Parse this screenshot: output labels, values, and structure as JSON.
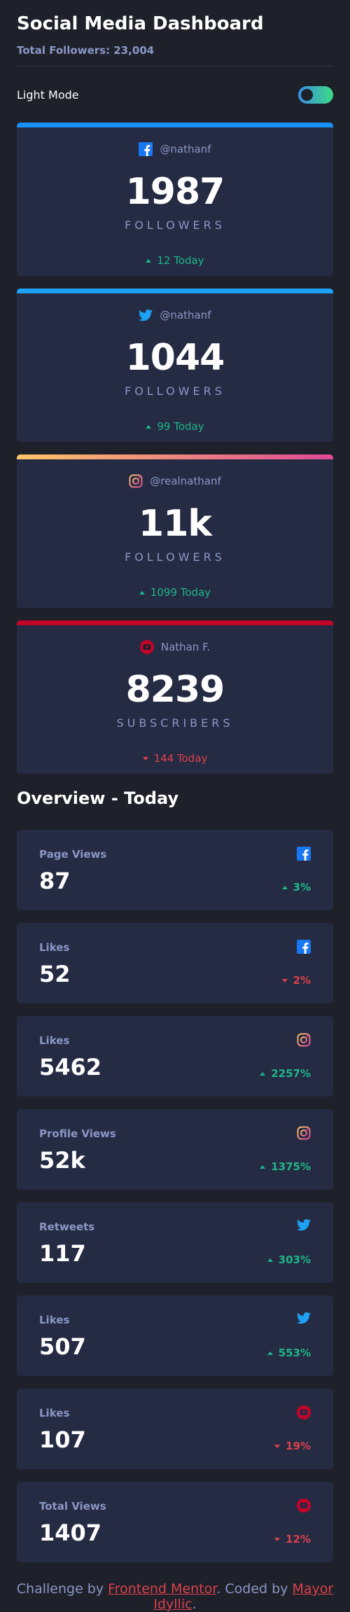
{
  "header": {
    "title": "Social Media Dashboard",
    "total_followers": "Total Followers: 23,004"
  },
  "mode": {
    "label": "Light Mode",
    "toggle_on": true
  },
  "colors": {
    "facebook": "#178ff5",
    "twitter": "#1da1f2",
    "instagram_start": "#fdc468",
    "instagram_end": "#df4996",
    "youtube": "#c4032a",
    "up": "#1eb589",
    "down": "#dc414c"
  },
  "cards": [
    {
      "platform": "facebook",
      "icon": "facebook-icon",
      "handle": "@nathanf",
      "count": "1987",
      "unit": "FOLLOWERS",
      "change": "12 Today",
      "direction": "up"
    },
    {
      "platform": "twitter",
      "icon": "twitter-icon",
      "handle": "@nathanf",
      "count": "1044",
      "unit": "FOLLOWERS",
      "change": "99 Today",
      "direction": "up"
    },
    {
      "platform": "instagram",
      "icon": "instagram-icon",
      "handle": "@realnathanf",
      "count": "11k",
      "unit": "FOLLOWERS",
      "change": "1099 Today",
      "direction": "up"
    },
    {
      "platform": "youtube",
      "icon": "youtube-icon",
      "handle": "Nathan F.",
      "count": "8239",
      "unit": "SUBSCRIBERS",
      "change": "144 Today",
      "direction": "down"
    }
  ],
  "overview": {
    "title": "Overview - Today",
    "items": [
      {
        "label": "Page Views",
        "icon": "facebook-icon",
        "value": "87",
        "change": "3%",
        "direction": "up"
      },
      {
        "label": "Likes",
        "icon": "facebook-icon",
        "value": "52",
        "change": "2%",
        "direction": "down"
      },
      {
        "label": "Likes",
        "icon": "instagram-icon",
        "value": "5462",
        "change": "2257%",
        "direction": "up"
      },
      {
        "label": "Profile Views",
        "icon": "instagram-icon",
        "value": "52k",
        "change": "1375%",
        "direction": "up"
      },
      {
        "label": "Retweets",
        "icon": "twitter-icon",
        "value": "117",
        "change": "303%",
        "direction": "up"
      },
      {
        "label": "Likes",
        "icon": "twitter-icon",
        "value": "507",
        "change": "553%",
        "direction": "up"
      },
      {
        "label": "Likes",
        "icon": "youtube-icon",
        "value": "107",
        "change": "19%",
        "direction": "down"
      },
      {
        "label": "Total Views",
        "icon": "youtube-icon",
        "value": "1407",
        "change": "12%",
        "direction": "down"
      }
    ]
  },
  "footer": {
    "prefix": "Challenge by ",
    "link1": "Frontend Mentor",
    "middle": ". Coded by ",
    "link2": "Mayor Idyllic",
    "suffix": "."
  }
}
